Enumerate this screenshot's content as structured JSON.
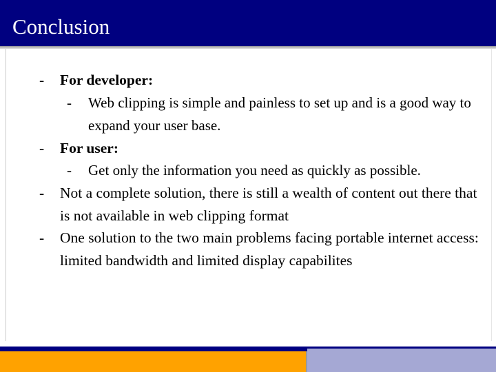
{
  "slide": {
    "title": "Conclusion",
    "theme": {
      "title_bar_color": "#000080",
      "title_text_color": "#ffffff",
      "body_background": "#ffffff",
      "body_text_color": "#000000",
      "footer_accent_orange": "#ffa200",
      "footer_accent_lavender": "#a5a8d4",
      "footer_strip_navy": "#000080"
    },
    "bullets": [
      {
        "level": 1,
        "marker": "-",
        "bold": true,
        "text": "For developer:"
      },
      {
        "level": 2,
        "marker": "-",
        "bold": false,
        "text": "Web clipping is simple and painless to set up and is a good way to expand your user base."
      },
      {
        "level": 1,
        "marker": "-",
        "bold": true,
        "text": "For user:"
      },
      {
        "level": 2,
        "marker": "-",
        "bold": false,
        "text": "Get only the information you need as quickly as possible."
      },
      {
        "level": 1,
        "marker": "-",
        "bold": false,
        "text": "Not a complete solution, there is still a wealth of content out there that is not available in web clipping format"
      },
      {
        "level": 1,
        "marker": "-",
        "bold": false,
        "text": "One solution to the two main problems facing portable internet access: limited bandwidth and limited display capabilites"
      }
    ]
  }
}
